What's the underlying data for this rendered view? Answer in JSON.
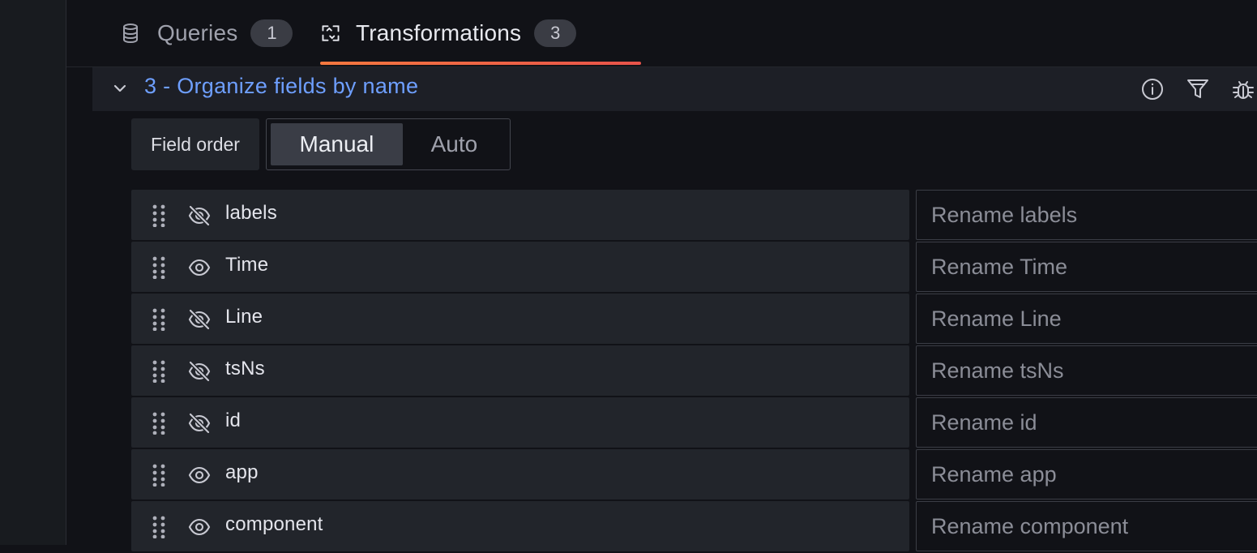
{
  "tabs": {
    "queries": {
      "label": "Queries",
      "count": "1",
      "icon": "database-icon"
    },
    "transformations": {
      "label": "Transformations",
      "count": "3",
      "icon": "transform-icon",
      "active": true
    }
  },
  "transformation": {
    "title": "3 - Organize fields by name",
    "actions": [
      "info-icon",
      "filter-icon",
      "bug-icon"
    ]
  },
  "field_order": {
    "label": "Field order",
    "options": [
      "Manual",
      "Auto"
    ],
    "selected": "Manual"
  },
  "fields": [
    {
      "name": "labels",
      "visible": false,
      "rename_placeholder": "Rename labels"
    },
    {
      "name": "Time",
      "visible": true,
      "rename_placeholder": "Rename Time"
    },
    {
      "name": "Line",
      "visible": false,
      "rename_placeholder": "Rename Line"
    },
    {
      "name": "tsNs",
      "visible": false,
      "rename_placeholder": "Rename tsNs"
    },
    {
      "name": "id",
      "visible": false,
      "rename_placeholder": "Rename id"
    },
    {
      "name": "app",
      "visible": true,
      "rename_placeholder": "Rename app"
    },
    {
      "name": "component",
      "visible": true,
      "rename_placeholder": "Rename component"
    }
  ],
  "colors": {
    "accent_title": "#6e9fff",
    "tab_underline": "#f5783f",
    "background": "#111217",
    "panel": "#22252b"
  }
}
